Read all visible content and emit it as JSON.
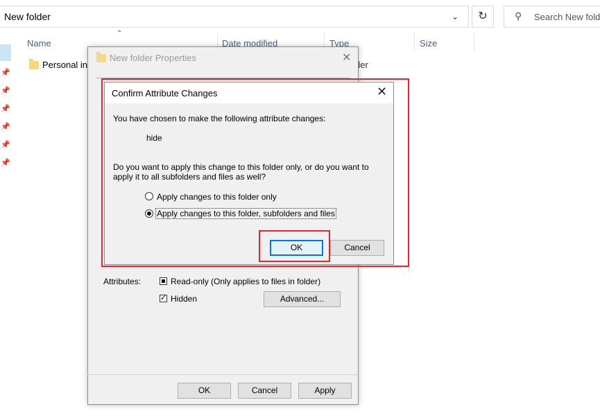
{
  "explorer": {
    "address": "New folder",
    "search_placeholder": "Search New fold",
    "columns": [
      "Name",
      "Date modified",
      "Type",
      "Size"
    ],
    "file_name": "Personal inf",
    "file_type_partial": "der"
  },
  "properties": {
    "title": "New folder Properties",
    "attributes_label": "Attributes:",
    "readonly_label": "Read-only (Only applies to files in folder)",
    "hidden_label": "Hidden",
    "advanced_label": "Advanced...",
    "ok_label": "OK",
    "cancel_label": "Cancel",
    "apply_label": "Apply"
  },
  "confirm": {
    "title": "Confirm Attribute Changes",
    "intro": "You have chosen to make the following attribute changes:",
    "change": "hide",
    "question_line1": "Do you want to apply this change to this folder only, or do you want to",
    "question_line2": "apply it to all subfolders and files as well?",
    "option1": "Apply changes to this folder only",
    "option2": "Apply changes to this folder, subfolders and files",
    "selected_option": 2,
    "ok_label": "OK",
    "cancel_label": "Cancel"
  },
  "highlight_color": "#e8262a"
}
